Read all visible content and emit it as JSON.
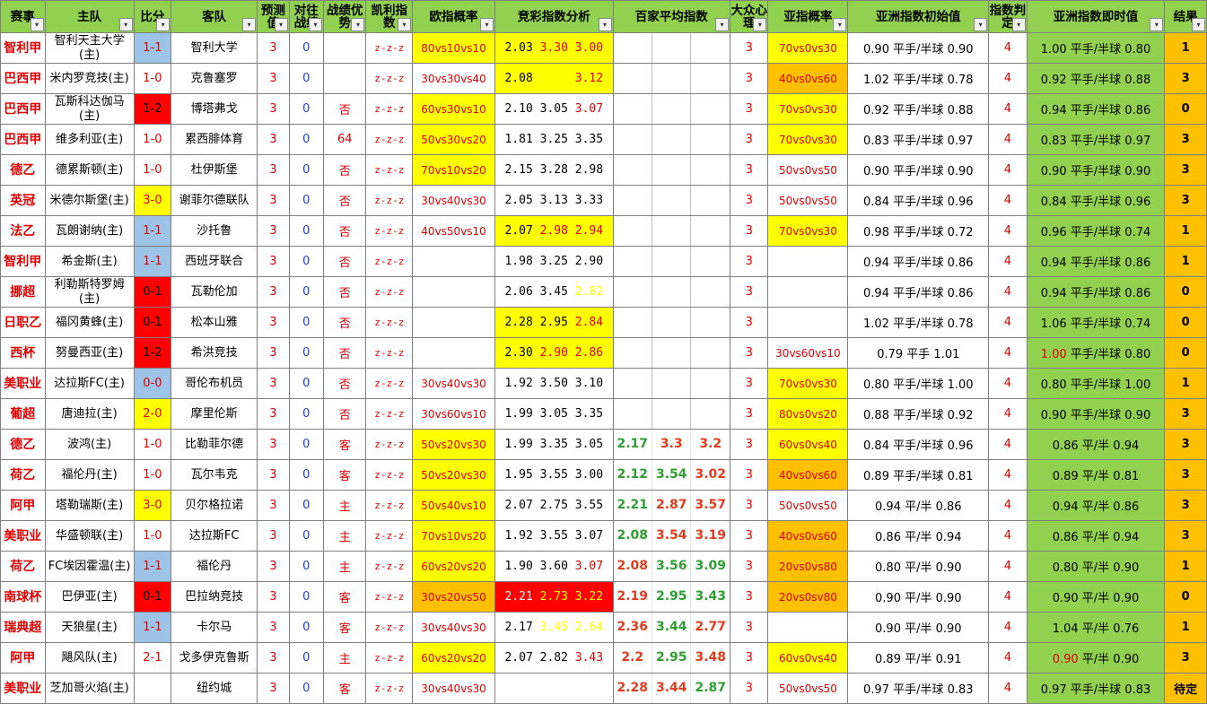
{
  "headers": [
    "赛事",
    "主队",
    "比分",
    "客队",
    "预测值",
    "对往战绩",
    "战绩优势",
    "凯利指数",
    "欧指概率",
    "竞彩指数分析",
    "百家平均指数",
    "大众心理",
    "亚指概率",
    "亚洲指数初始值",
    "指数判定",
    "亚洲指数即时值",
    "结果"
  ],
  "header_icons": {
    "filter": "filter-dropdown-icon"
  },
  "rows": [
    {
      "league": "智利甲",
      "home": "智利天主大学(主)",
      "score": "1-1",
      "score_bg": "blue",
      "away": "智利大学",
      "pred": "3",
      "hist": "0",
      "adv": "",
      "kelly": "z-z-z",
      "prob": "80vs10vs10",
      "prob_bg": "yellow",
      "jc": [
        "2.03",
        "3.30",
        "3.00"
      ],
      "jc_colors": [
        "",
        "r",
        "r"
      ],
      "jc_bg": "yellow",
      "bj": [
        "",
        "",
        ""
      ],
      "mass": "3",
      "aprob": "70vs0vs30",
      "aprob_bg": "yellow",
      "ainit": "0.90 平手/半球 0.90",
      "judge": "4",
      "anow": "1.00 平手/半球 0.80",
      "anow_red": "",
      "result": "1"
    },
    {
      "league": "巴西甲",
      "home": "米内罗竞技(主)",
      "score": "1-0",
      "score_bg": "",
      "away": "克鲁塞罗",
      "pred": "3",
      "hist": "0",
      "adv": "",
      "kelly": "z-z-z",
      "prob": "30vs30vs40",
      "prob_bg": "",
      "jc": [
        "2.08",
        "3.05",
        "3.12"
      ],
      "jc_colors": [
        "",
        "y",
        "r"
      ],
      "jc_bg": "yellow",
      "bj": [
        "",
        "",
        ""
      ],
      "mass": "3",
      "aprob": "40vs0vs60",
      "aprob_bg": "orange",
      "ainit": "1.02 平手/半球 0.78",
      "judge": "4",
      "anow": "0.92 平手/半球 0.88",
      "anow_red": "",
      "result": "3"
    },
    {
      "league": "巴西甲",
      "home": "瓦斯科达伽马(主)",
      "score": "1-2",
      "score_bg": "red",
      "away": "博塔弗戈",
      "pred": "3",
      "hist": "0",
      "adv": "否",
      "kelly": "z-z-z",
      "prob": "60vs30vs10",
      "prob_bg": "yellow",
      "jc": [
        "2.10",
        "3.05",
        "3.07"
      ],
      "jc_colors": [
        "",
        "",
        "r"
      ],
      "jc_bg": "",
      "bj": [
        "",
        "",
        ""
      ],
      "mass": "3",
      "aprob": "70vs0vs30",
      "aprob_bg": "yellow",
      "ainit": "0.92 平手/半球 0.88",
      "judge": "4",
      "anow": "0.94 平手/半球 0.86",
      "anow_red": "",
      "result": "0"
    },
    {
      "league": "巴西甲",
      "home": "维多利亚(主)",
      "score": "1-0",
      "score_bg": "",
      "away": "累西腓体育",
      "pred": "3",
      "hist": "0",
      "adv": "64",
      "kelly": "z-z-z",
      "prob": "50vs30vs20",
      "prob_bg": "yellow",
      "jc": [
        "1.81",
        "3.25",
        "3.35"
      ],
      "jc_colors": [
        "",
        "",
        ""
      ],
      "jc_bg": "",
      "bj": [
        "",
        "",
        ""
      ],
      "mass": "3",
      "aprob": "70vs0vs30",
      "aprob_bg": "yellow",
      "ainit": "0.83 平手/半球 0.97",
      "judge": "4",
      "anow": "0.83 平手/半球 0.97",
      "anow_red": "",
      "result": "3"
    },
    {
      "league": "德乙",
      "home": "德累斯顿(主)",
      "score": "1-0",
      "score_bg": "",
      "away": "杜伊斯堡",
      "pred": "3",
      "hist": "0",
      "adv": "否",
      "kelly": "z-z-z",
      "prob": "70vs10vs20",
      "prob_bg": "yellow",
      "jc": [
        "2.15",
        "3.28",
        "2.98"
      ],
      "jc_colors": [
        "",
        "",
        ""
      ],
      "jc_bg": "",
      "bj": [
        "",
        "",
        ""
      ],
      "mass": "3",
      "aprob": "50vs0vs50",
      "aprob_bg": "",
      "ainit": "0.90 平手/半球 0.90",
      "judge": "4",
      "anow": "0.90 平手/半球 0.90",
      "anow_red": "",
      "result": "3"
    },
    {
      "league": "英冠",
      "home": "米德尔斯堡(主)",
      "score": "3-0",
      "score_bg": "yellow",
      "away": "谢菲尔德联队",
      "pred": "3",
      "hist": "0",
      "adv": "否",
      "kelly": "z-z-z",
      "prob": "30vs40vs30",
      "prob_bg": "",
      "jc": [
        "2.05",
        "3.13",
        "3.33"
      ],
      "jc_colors": [
        "",
        "",
        ""
      ],
      "jc_bg": "",
      "bj": [
        "",
        "",
        ""
      ],
      "mass": "3",
      "aprob": "50vs0vs50",
      "aprob_bg": "",
      "ainit": "0.84 平手/半球 0.96",
      "judge": "4",
      "anow": "0.84 平手/半球 0.96",
      "anow_red": "",
      "result": "3"
    },
    {
      "league": "法乙",
      "home": "瓦朗谢纳(主)",
      "score": "1-1",
      "score_bg": "blue",
      "away": "沙托鲁",
      "pred": "3",
      "hist": "0",
      "adv": "否",
      "kelly": "z-z-z",
      "prob": "40vs50vs10",
      "prob_bg": "",
      "jc": [
        "2.07",
        "2.98",
        "2.94"
      ],
      "jc_colors": [
        "",
        "r",
        "r"
      ],
      "jc_bg": "yellow",
      "bj": [
        "",
        "",
        ""
      ],
      "mass": "3",
      "aprob": "70vs0vs30",
      "aprob_bg": "yellow",
      "ainit": "0.98 平手/半球 0.72",
      "judge": "4",
      "anow": "0.96 平手/半球 0.74",
      "anow_red": "",
      "result": "1"
    },
    {
      "league": "智利甲",
      "home": "希金斯(主)",
      "score": "1-1",
      "score_bg": "blue",
      "away": "西班牙联合",
      "pred": "3",
      "hist": "0",
      "adv": "否",
      "kelly": "z-z-z",
      "prob": "",
      "prob_bg": "",
      "jc": [
        "1.98",
        "3.25",
        "2.90"
      ],
      "jc_colors": [
        "",
        "",
        ""
      ],
      "jc_bg": "",
      "bj": [
        "",
        "",
        ""
      ],
      "mass": "3",
      "aprob": "",
      "aprob_bg": "",
      "ainit": "0.94 平手/半球 0.86",
      "judge": "4",
      "anow": "0.94 平手/半球 0.86",
      "anow_red": "",
      "result": "1"
    },
    {
      "league": "挪超",
      "home": "利勒斯特罗姆(主)",
      "score": "0-1",
      "score_bg": "red",
      "away": "瓦勒伦加",
      "pred": "3",
      "hist": "0",
      "adv": "否",
      "kelly": "z-z-z",
      "prob": "",
      "prob_bg": "",
      "jc": [
        "2.06",
        "3.45",
        "2.82"
      ],
      "jc_colors": [
        "",
        "",
        "y"
      ],
      "jc_bg": "",
      "bj": [
        "",
        "",
        ""
      ],
      "mass": "3",
      "aprob": "",
      "aprob_bg": "",
      "ainit": "0.94 平手/半球 0.86",
      "judge": "4",
      "anow": "0.94 平手/半球 0.86",
      "anow_red": "",
      "result": "0"
    },
    {
      "league": "日职乙",
      "home": "福冈黄蜂(主)",
      "score": "0-1",
      "score_bg": "red",
      "away": "松本山雅",
      "pred": "3",
      "hist": "0",
      "adv": "否",
      "kelly": "z-z-z",
      "prob": "",
      "prob_bg": "",
      "jc": [
        "2.28",
        "2.95",
        "2.84"
      ],
      "jc_colors": [
        "",
        "",
        "r"
      ],
      "jc_bg": "yellow",
      "bj": [
        "",
        "",
        ""
      ],
      "mass": "3",
      "aprob": "",
      "aprob_bg": "",
      "ainit": "1.02 平手/半球 0.78",
      "judge": "4",
      "anow": "1.06 平手/半球 0.74",
      "anow_red": "",
      "result": "0"
    },
    {
      "league": "西杯",
      "home": "努曼西亚(主)",
      "score": "1-2",
      "score_bg": "red",
      "away": "希洪竞技",
      "pred": "3",
      "hist": "0",
      "adv": "否",
      "kelly": "z-z-z",
      "prob": "",
      "prob_bg": "",
      "jc": [
        "2.30",
        "2.90",
        "2.86"
      ],
      "jc_colors": [
        "",
        "r",
        "r"
      ],
      "jc_bg": "yellow",
      "bj": [
        "",
        "",
        ""
      ],
      "mass": "3",
      "aprob": "30vs60vs10",
      "aprob_bg": "",
      "ainit": "0.79 平手 1.01",
      "judge": "4",
      "anow": "1.00 平手/半球 0.80",
      "anow_red": "1.00",
      "result": "0"
    },
    {
      "league": "美职业",
      "home": "达拉斯FC(主)",
      "score": "0-0",
      "score_bg": "blue",
      "away": "哥伦布机员",
      "pred": "3",
      "hist": "0",
      "adv": "否",
      "kelly": "z-z-z",
      "prob": "30vs40vs30",
      "prob_bg": "",
      "jc": [
        "1.92",
        "3.50",
        "3.10"
      ],
      "jc_colors": [
        "",
        "",
        ""
      ],
      "jc_bg": "",
      "bj": [
        "",
        "",
        ""
      ],
      "mass": "3",
      "aprob": "70vs0vs30",
      "aprob_bg": "yellow",
      "ainit": "0.80 平手/半球 1.00",
      "judge": "4",
      "anow": "0.80 平手/半球 1.00",
      "anow_red": "",
      "result": "1"
    },
    {
      "league": "葡超",
      "home": "唐迪拉(主)",
      "score": "2-0",
      "score_bg": "yellow",
      "away": "摩里伦斯",
      "pred": "3",
      "hist": "0",
      "adv": "否",
      "kelly": "z-z-z",
      "prob": "30vs60vs10",
      "prob_bg": "",
      "jc": [
        "1.99",
        "3.05",
        "3.35"
      ],
      "jc_colors": [
        "",
        "",
        ""
      ],
      "jc_bg": "",
      "bj": [
        "",
        "",
        ""
      ],
      "mass": "3",
      "aprob": "80vs0vs20",
      "aprob_bg": "yellow",
      "ainit": "0.88 平手/半球 0.92",
      "judge": "4",
      "anow": "0.90 平手/半球 0.90",
      "anow_red": "",
      "result": "3"
    },
    {
      "league": "德乙",
      "home": "波鸿(主)",
      "score": "1-0",
      "score_bg": "",
      "away": "比勒菲尔德",
      "pred": "3",
      "hist": "0",
      "adv": "客",
      "kelly": "z-z-z",
      "prob": "50vs20vs30",
      "prob_bg": "yellow",
      "jc": [
        "1.99",
        "3.35",
        "3.05"
      ],
      "jc_colors": [
        "",
        "",
        ""
      ],
      "jc_bg": "",
      "bj": [
        "2.17",
        "3.3",
        "3.2"
      ],
      "mass": "3",
      "aprob": "60vs0vs40",
      "aprob_bg": "yellow",
      "ainit": "0.84 平手/半球 0.96",
      "judge": "4",
      "anow": "0.86 平/半 0.94",
      "anow_red": "",
      "result": "3"
    },
    {
      "league": "荷乙",
      "home": "福伦丹(主)",
      "score": "1-0",
      "score_bg": "",
      "away": "瓦尔韦克",
      "pred": "3",
      "hist": "0",
      "adv": "客",
      "kelly": "z-z-z",
      "prob": "50vs20vs30",
      "prob_bg": "yellow",
      "jc": [
        "1.95",
        "3.55",
        "3.00"
      ],
      "jc_colors": [
        "",
        "",
        ""
      ],
      "jc_bg": "",
      "bj": [
        "2.12",
        "3.54",
        "3.02"
      ],
      "mass": "3",
      "aprob": "40vs0vs60",
      "aprob_bg": "orange",
      "ainit": "0.89 平手/半球 0.81",
      "judge": "4",
      "anow": "0.89 平/半 0.81",
      "anow_red": "",
      "result": "3"
    },
    {
      "league": "阿甲",
      "home": "塔勒瑞斯(主)",
      "score": "3-0",
      "score_bg": "yellow",
      "away": "贝尔格拉诺",
      "pred": "3",
      "hist": "0",
      "adv": "主",
      "kelly": "z-z-z",
      "prob": "50vs40vs10",
      "prob_bg": "yellow",
      "jc": [
        "2.07",
        "2.75",
        "3.55"
      ],
      "jc_colors": [
        "",
        "",
        ""
      ],
      "jc_bg": "",
      "bj": [
        "2.21",
        "2.87",
        "3.57"
      ],
      "mass": "3",
      "aprob": "50vs0vs50",
      "aprob_bg": "",
      "ainit": "0.94 平/半 0.86",
      "judge": "4",
      "anow": "0.94 平/半 0.86",
      "anow_red": "",
      "result": "3"
    },
    {
      "league": "美职业",
      "home": "华盛顿联(主)",
      "score": "1-0",
      "score_bg": "",
      "away": "达拉斯FC",
      "pred": "3",
      "hist": "0",
      "adv": "主",
      "kelly": "z-z-z",
      "prob": "70vs10vs20",
      "prob_bg": "yellow",
      "jc": [
        "1.92",
        "3.55",
        "3.07"
      ],
      "jc_colors": [
        "",
        "",
        ""
      ],
      "jc_bg": "",
      "bj": [
        "2.08",
        "3.54",
        "3.19"
      ],
      "mass": "3",
      "aprob": "40vs0vs60",
      "aprob_bg": "orange",
      "ainit": "0.86 平/半 0.94",
      "judge": "4",
      "anow": "0.86 平/半 0.94",
      "anow_red": "",
      "result": "3"
    },
    {
      "league": "荷乙",
      "home": "FC埃因霍温(主)",
      "score": "1-1",
      "score_bg": "blue",
      "away": "福伦丹",
      "pred": "3",
      "hist": "0",
      "adv": "主",
      "kelly": "z-z-z",
      "prob": "60vs20vs20",
      "prob_bg": "yellow",
      "jc": [
        "1.90",
        "3.60",
        "3.07"
      ],
      "jc_colors": [
        "",
        "",
        "r"
      ],
      "jc_bg": "",
      "bj": [
        "2.08",
        "3.56",
        "3.09"
      ],
      "mass": "3",
      "aprob": "20vs0vs80",
      "aprob_bg": "orange",
      "ainit": "0.80 平/半 0.90",
      "judge": "4",
      "anow": "0.80 平/半 0.90",
      "anow_red": "",
      "result": "1"
    },
    {
      "league": "南球杯",
      "home": "巴伊亚(主)",
      "score": "0-1",
      "score_bg": "red",
      "away": "巴拉纳竞技",
      "pred": "3",
      "hist": "0",
      "adv": "客",
      "kelly": "z-z-z",
      "prob": "30vs20vs50",
      "prob_bg": "orange",
      "jc": [
        "2.21",
        "2.73",
        "3.22"
      ],
      "jc_colors": [
        "",
        "r",
        "r"
      ],
      "jc_bg": "red",
      "bj": [
        "2.19",
        "2.95",
        "3.43"
      ],
      "mass": "3",
      "aprob": "20vs0sv80",
      "aprob_bg": "orange",
      "ainit": "0.90 平/半 0.90",
      "judge": "4",
      "anow": "0.90 平/半 0.90",
      "anow_red": "",
      "result": "0"
    },
    {
      "league": "瑞典超",
      "home": "天狼星(主)",
      "score": "1-1",
      "score_bg": "blue",
      "away": "卡尔马",
      "pred": "3",
      "hist": "0",
      "adv": "客",
      "kelly": "z-z-z",
      "prob": "30vs40vs30",
      "prob_bg": "",
      "jc": [
        "2.17",
        "3.45",
        "2.64"
      ],
      "jc_colors": [
        "",
        "y",
        "y"
      ],
      "jc_bg": "",
      "bj": [
        "2.36",
        "3.44",
        "2.77"
      ],
      "mass": "3",
      "aprob": "",
      "aprob_bg": "",
      "ainit": "0.90 平/半 0.90",
      "judge": "4",
      "anow": "1.04 平/半 0.76",
      "anow_red": "",
      "result": "1"
    },
    {
      "league": "阿甲",
      "home": "飓风队(主)",
      "score": "2-1",
      "score_bg": "",
      "away": "戈多伊克鲁斯",
      "pred": "3",
      "hist": "0",
      "adv": "主",
      "kelly": "z-z-z",
      "prob": "60vs20vs20",
      "prob_bg": "yellow",
      "jc": [
        "2.07",
        "2.82",
        "3.43"
      ],
      "jc_colors": [
        "",
        "",
        "r"
      ],
      "jc_bg": "",
      "bj": [
        "2.2",
        "2.95",
        "3.48"
      ],
      "mass": "3",
      "aprob": "60vs0vs40",
      "aprob_bg": "yellow",
      "ainit": "0.89 平/半 0.91",
      "judge": "4",
      "anow": "0.90 平/半 0.90",
      "anow_red": "0.90",
      "result": "3"
    },
    {
      "league": "美职业",
      "home": "芝加哥火焰(主)",
      "score": "",
      "score_bg": "",
      "away": "纽约城",
      "pred": "3",
      "hist": "0",
      "adv": "客",
      "kelly": "z-z-z",
      "prob": "30vs40vs30",
      "prob_bg": "",
      "jc": [
        "",
        "",
        ""
      ],
      "jc_colors": [
        "",
        "",
        ""
      ],
      "jc_bg": "",
      "bj": [
        "2.28",
        "3.44",
        "2.87"
      ],
      "mass": "3",
      "aprob": "50vs0vs50",
      "aprob_bg": "",
      "ainit": "0.97 平手/半球 0.83",
      "judge": "4",
      "anow": "0.97 平手/半球 0.83",
      "anow_red": "",
      "result": "待定"
    }
  ]
}
